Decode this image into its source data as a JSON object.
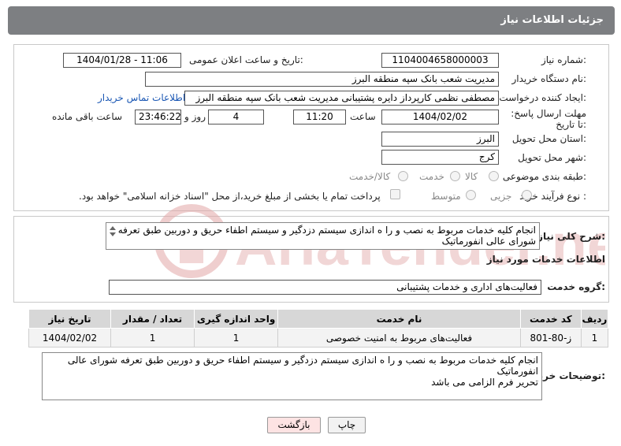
{
  "header": {
    "title": "جزئیات اطلاعات نیاز"
  },
  "form": {
    "need_number_label": "شماره نیاز:",
    "need_number": "1104004658000003",
    "announce_label": "تاریخ و ساعت اعلان عمومی:",
    "announce_value": "1404/01/28 - 11:06",
    "buyer_org_label": "نام دستگاه خریدار:",
    "buyer_org": "مدیریت شعب بانک سپه منطقه البرز",
    "requester_label": "ایجاد کننده درخواست:",
    "requester": "مصطفی نظمی کارپرداز دایره پشتیبانی مدیریت شعب بانک سپه منطقه البرز",
    "contact_link": "اطلاعات تماس خریدار",
    "deadline_label": "مهلت ارسال پاسخ: تا تاریخ:",
    "deadline_date": "1404/02/02",
    "time_label": "ساعت",
    "deadline_time": "11:20",
    "days_value": "4",
    "days_label": "روز و",
    "remaining_time": "23:46:22",
    "remaining_label": "ساعت باقی مانده",
    "province_label": "استان محل تحویل:",
    "province": "البرز",
    "city_label": "شهر محل تحویل:",
    "city": "کرج",
    "category_label": "طبقه بندی موضوعی:",
    "category_options": [
      "کالا",
      "خدمت",
      "کالا/خدمت"
    ],
    "process_label": "نوع فرآیند خرید :",
    "process_options": [
      "جزیی",
      "متوسط"
    ],
    "payment_note": "پرداخت تمام یا بخشی از مبلغ خرید،از محل \"اسناد خزانه اسلامی\" خواهد بود."
  },
  "summary": {
    "label": "شرح کلی نیاز:",
    "text": "انجام کلیه خدمات مربوط به نصب و را ه اندازی سیستم دزدگیر و سیستم اطفاء حریق و دوربین طبق تعرفه شورای عالی انفورماتیک"
  },
  "services": {
    "section_title": "اطلاعات خدمات مورد نیاز",
    "group_label": "گروه خدمت:",
    "group_value": "فعالیت‌های اداری و خدمات پشتیبانی",
    "columns": [
      "ردیف",
      "کد خدمت",
      "نام خدمت",
      "واحد اندازه گیری",
      "تعداد / مقدار",
      "تاریخ نیاز"
    ],
    "rows": [
      [
        "1",
        "ز-80-801",
        "فعالیت‌های مربوط به امنیت خصوصی",
        "1",
        "1",
        "1404/02/02"
      ]
    ]
  },
  "buyer_notes": {
    "label": "توضیحات خریدار:",
    "line1": "انجام کلیه خدمات مربوط به نصب و را ه اندازی سیستم دزدگیر و سیستم اطفاء حریق و دوربین طبق تعرفه شورای عالی انفورماتیک",
    "line2": "تحریر فرم الزامی می باشد"
  },
  "buttons": {
    "print": "چاپ",
    "back": "بازگشت"
  },
  "watermark": {
    "text": "AriaTender.neT"
  },
  "colors": {
    "header_bg": "#7d7f82",
    "link": "#1a57b4",
    "back_btn_bg": "#fde3e3",
    "watermark": "#e2a5a5"
  }
}
